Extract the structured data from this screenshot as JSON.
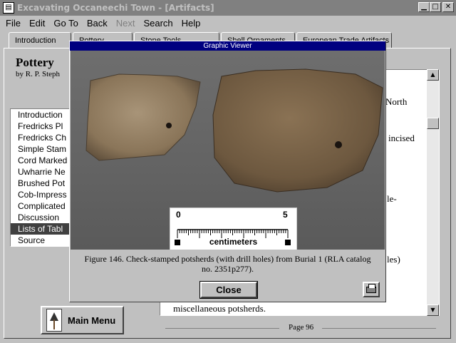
{
  "window": {
    "title": "Excavating Occaneechi Town - [Artifacts]",
    "app_icon": "book-icon",
    "buttons": [
      "minimize",
      "maximize",
      "close"
    ]
  },
  "menu": {
    "items": [
      {
        "label": "File",
        "enabled": true
      },
      {
        "label": "Edit",
        "enabled": true
      },
      {
        "label": "Go To",
        "enabled": true
      },
      {
        "label": "Back",
        "enabled": true
      },
      {
        "label": "Next",
        "enabled": false
      },
      {
        "label": "Search",
        "enabled": true
      },
      {
        "label": "Help",
        "enabled": true
      }
    ]
  },
  "tabs": [
    {
      "label": "Introduction",
      "active": true
    },
    {
      "label": "Pottery",
      "active": false
    },
    {
      "label": "Stone Tools",
      "active": false
    },
    {
      "label": "Shell Ornaments",
      "active": false
    },
    {
      "label": "European Trade Artifacts",
      "active": false
    }
  ],
  "page": {
    "title": "Pottery",
    "byline": "by R. P. Steph",
    "page_number": "Page 96"
  },
  "toc": {
    "items": [
      {
        "label": "Introduction",
        "selected": false
      },
      {
        "label": "Fredricks Pl",
        "selected": false
      },
      {
        "label": "Fredricks Ch",
        "selected": false
      },
      {
        "label": "Simple Stam",
        "selected": false
      },
      {
        "label": "Cord Marked",
        "selected": false
      },
      {
        "label": "Uwharrie Ne",
        "selected": false
      },
      {
        "label": "Brushed Pot",
        "selected": false
      },
      {
        "label": "Cob-Impress",
        "selected": false
      },
      {
        "label": "Complicated",
        "selected": false
      },
      {
        "label": "Discussion",
        "selected": false
      },
      {
        "label": "Lists of Tabl",
        "selected": true
      },
      {
        "label": "Source",
        "selected": false
      }
    ]
  },
  "main_menu_button": {
    "label": "Main Menu",
    "icon": "arrowhead-icon"
  },
  "text_panel": {
    "visible_fragments": {
      "north": "North",
      "incised": "incised",
      "le": "le-",
      "les": "les)",
      "bottom_line": "miscellaneous potsherds."
    }
  },
  "viewer": {
    "title": "Graphic Viewer",
    "caption_line1": "Figure 146.  Check-stamped potsherds (with drill holes) from Burial 1 (RLA catalog",
    "caption_line2": "no. 2351p277).",
    "close_label": "Close",
    "print_icon": "printer-icon",
    "scale_bar": {
      "min": "0",
      "max": "5",
      "unit": "centimeters"
    }
  }
}
